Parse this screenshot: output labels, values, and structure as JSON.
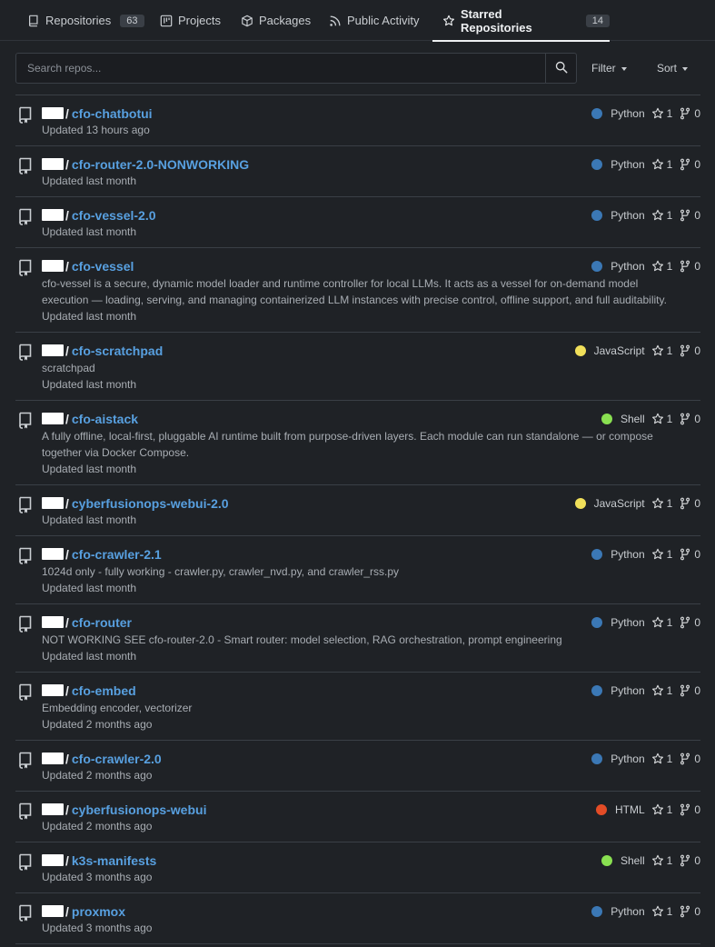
{
  "tabs": [
    {
      "label": "Repositories",
      "count": "63",
      "icon": "repo-icon"
    },
    {
      "label": "Projects",
      "icon": "project-icon"
    },
    {
      "label": "Packages",
      "icon": "package-icon"
    },
    {
      "label": "Public Activity",
      "icon": "rss-icon"
    },
    {
      "label": "Starred Repositories",
      "count": "14",
      "icon": "star-icon",
      "active": true
    }
  ],
  "search": {
    "placeholder": "Search repos..."
  },
  "filter": {
    "label": "Filter"
  },
  "sort": {
    "label": "Sort"
  },
  "colors": {
    "Python": "#3b78b5",
    "JavaScript": "#f1e05a",
    "Shell": "#89e051",
    "HTML": "#e34c26"
  },
  "repos": [
    {
      "name": "cfo-chatbotui",
      "description": "",
      "updated": "Updated 13 hours ago",
      "language": "Python",
      "stars": "1",
      "forks": "0"
    },
    {
      "name": "cfo-router-2.0-NONWORKING",
      "description": "",
      "updated": "Updated last month",
      "language": "Python",
      "stars": "1",
      "forks": "0"
    },
    {
      "name": "cfo-vessel-2.0",
      "description": "",
      "updated": "Updated last month",
      "language": "Python",
      "stars": "1",
      "forks": "0"
    },
    {
      "name": "cfo-vessel",
      "description": "cfo-vessel is a secure, dynamic model loader and runtime controller for local LLMs. It acts as a vessel for on-demand model execution — loading, serving, and managing containerized LLM instances with precise control, offline support, and full auditability.",
      "updated": "Updated last month",
      "language": "Python",
      "stars": "1",
      "forks": "0"
    },
    {
      "name": "cfo-scratchpad",
      "description": "scratchpad",
      "updated": "Updated last month",
      "language": "JavaScript",
      "stars": "1",
      "forks": "0"
    },
    {
      "name": "cfo-aistack",
      "description": "A fully offline, local-first, pluggable AI runtime built from purpose-driven layers. Each module can run standalone — or compose together via Docker Compose.",
      "updated": "Updated last month",
      "language": "Shell",
      "stars": "1",
      "forks": "0"
    },
    {
      "name": "cyberfusionops-webui-2.0",
      "description": "",
      "updated": "Updated last month",
      "language": "JavaScript",
      "stars": "1",
      "forks": "0"
    },
    {
      "name": "cfo-crawler-2.1",
      "description": "1024d only - fully working - crawler.py, crawler_nvd.py, and crawler_rss.py",
      "updated": "Updated last month",
      "language": "Python",
      "stars": "1",
      "forks": "0"
    },
    {
      "name": "cfo-router",
      "description": "NOT WORKING SEE cfo-router-2.0 - Smart router: model selection, RAG orchestration, prompt engineering",
      "updated": "Updated last month",
      "language": "Python",
      "stars": "1",
      "forks": "0"
    },
    {
      "name": "cfo-embed",
      "description": "Embedding encoder, vectorizer",
      "updated": "Updated 2 months ago",
      "language": "Python",
      "stars": "1",
      "forks": "0"
    },
    {
      "name": "cfo-crawler-2.0",
      "description": "",
      "updated": "Updated 2 months ago",
      "language": "Python",
      "stars": "1",
      "forks": "0"
    },
    {
      "name": "cyberfusionops-webui",
      "description": "",
      "updated": "Updated 2 months ago",
      "language": "HTML",
      "stars": "1",
      "forks": "0"
    },
    {
      "name": "k3s-manifests",
      "description": "",
      "updated": "Updated 3 months ago",
      "language": "Shell",
      "stars": "1",
      "forks": "0"
    },
    {
      "name": "proxmox",
      "description": "",
      "updated": "Updated 3 months ago",
      "language": "Python",
      "stars": "1",
      "forks": "0"
    }
  ]
}
